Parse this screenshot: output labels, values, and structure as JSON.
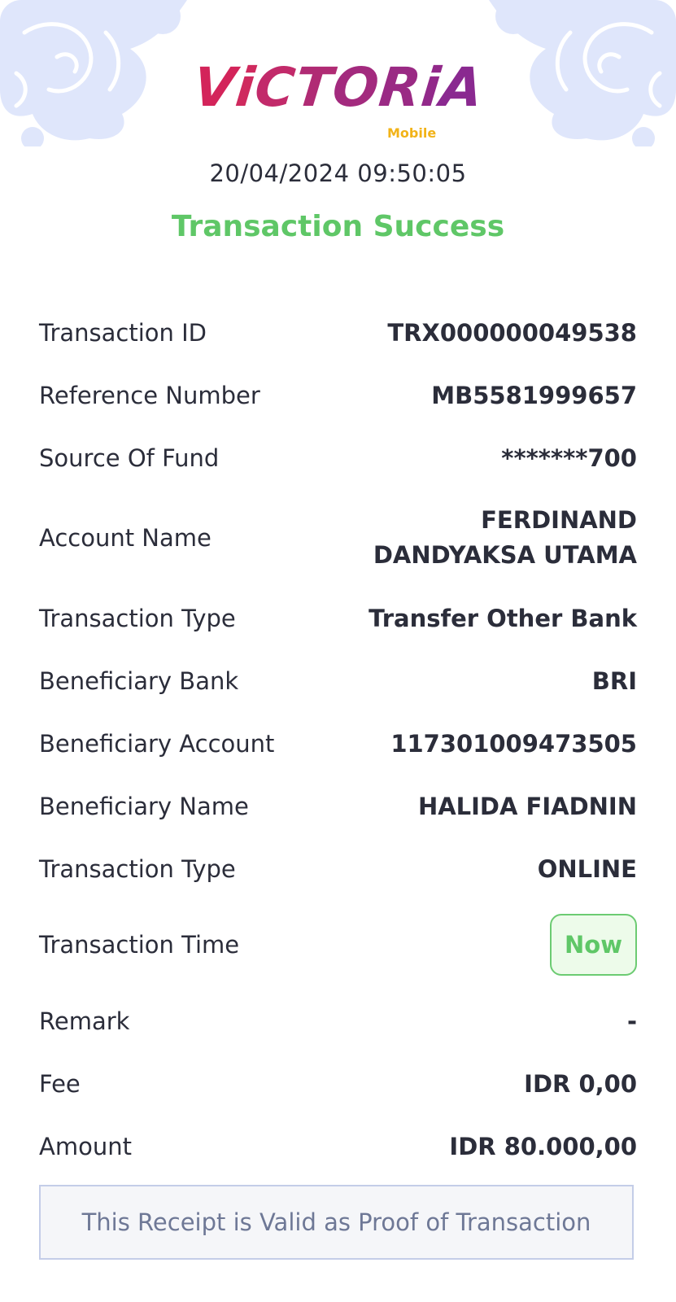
{
  "brand": {
    "name": "VICTORIA",
    "letters": [
      {
        "ch": "V",
        "color": "#d3245a"
      },
      {
        "ch": "i",
        "color": "#cf2a5e"
      },
      {
        "ch": "C",
        "color": "#c22a6a"
      },
      {
        "ch": "T",
        "color": "#b02b74"
      },
      {
        "ch": "O",
        "color": "#a32a7e"
      },
      {
        "ch": "R",
        "color": "#9a2a84"
      },
      {
        "ch": "i",
        "color": "#92298a"
      },
      {
        "ch": "A",
        "color": "#8a2990"
      }
    ],
    "sub": "Mobile",
    "colors": {
      "primary": "#b02b74",
      "accent": "#f2b318"
    }
  },
  "receipt": {
    "datetime": "20/04/2024 09:50:05",
    "status": "Transaction Success",
    "rows": {
      "transaction_id": {
        "label": "Transaction ID",
        "value": "TRX000000049538"
      },
      "reference_number": {
        "label": "Reference Number",
        "value": "MB5581999657"
      },
      "source_of_fund": {
        "label": "Source Of Fund",
        "value": "*******700"
      },
      "account_name": {
        "label": "Account Name",
        "value_line1": "FERDINAND",
        "value_line2": "DANDYAKSA UTAMA"
      },
      "transaction_type": {
        "label": "Transaction Type",
        "value": "Transfer Other Bank"
      },
      "beneficiary_bank": {
        "label": "Beneficiary Bank",
        "value": "BRI"
      },
      "beneficiary_account": {
        "label": "Beneficiary Account",
        "value": "117301009473505"
      },
      "beneficiary_name": {
        "label": "Beneficiary Name",
        "value": "HALIDA FIADNIN"
      },
      "transfer_method": {
        "label": "Transaction Type",
        "value": "ONLINE"
      },
      "transaction_time": {
        "label": "Transaction Time",
        "value": "Now"
      },
      "remark": {
        "label": "Remark",
        "value": "-"
      },
      "fee": {
        "label": "Fee",
        "value": "IDR 0,00"
      },
      "amount": {
        "label": "Amount",
        "value": "IDR 80.000,00"
      }
    },
    "footer_note": "This Receipt is Valid as Proof of Transaction"
  },
  "colors": {
    "success": "#5fc767",
    "badge_bg": "#edfbea",
    "ornament": "#dfe6fb",
    "text": "#2b2d3a",
    "note_text": "#6e7896"
  }
}
